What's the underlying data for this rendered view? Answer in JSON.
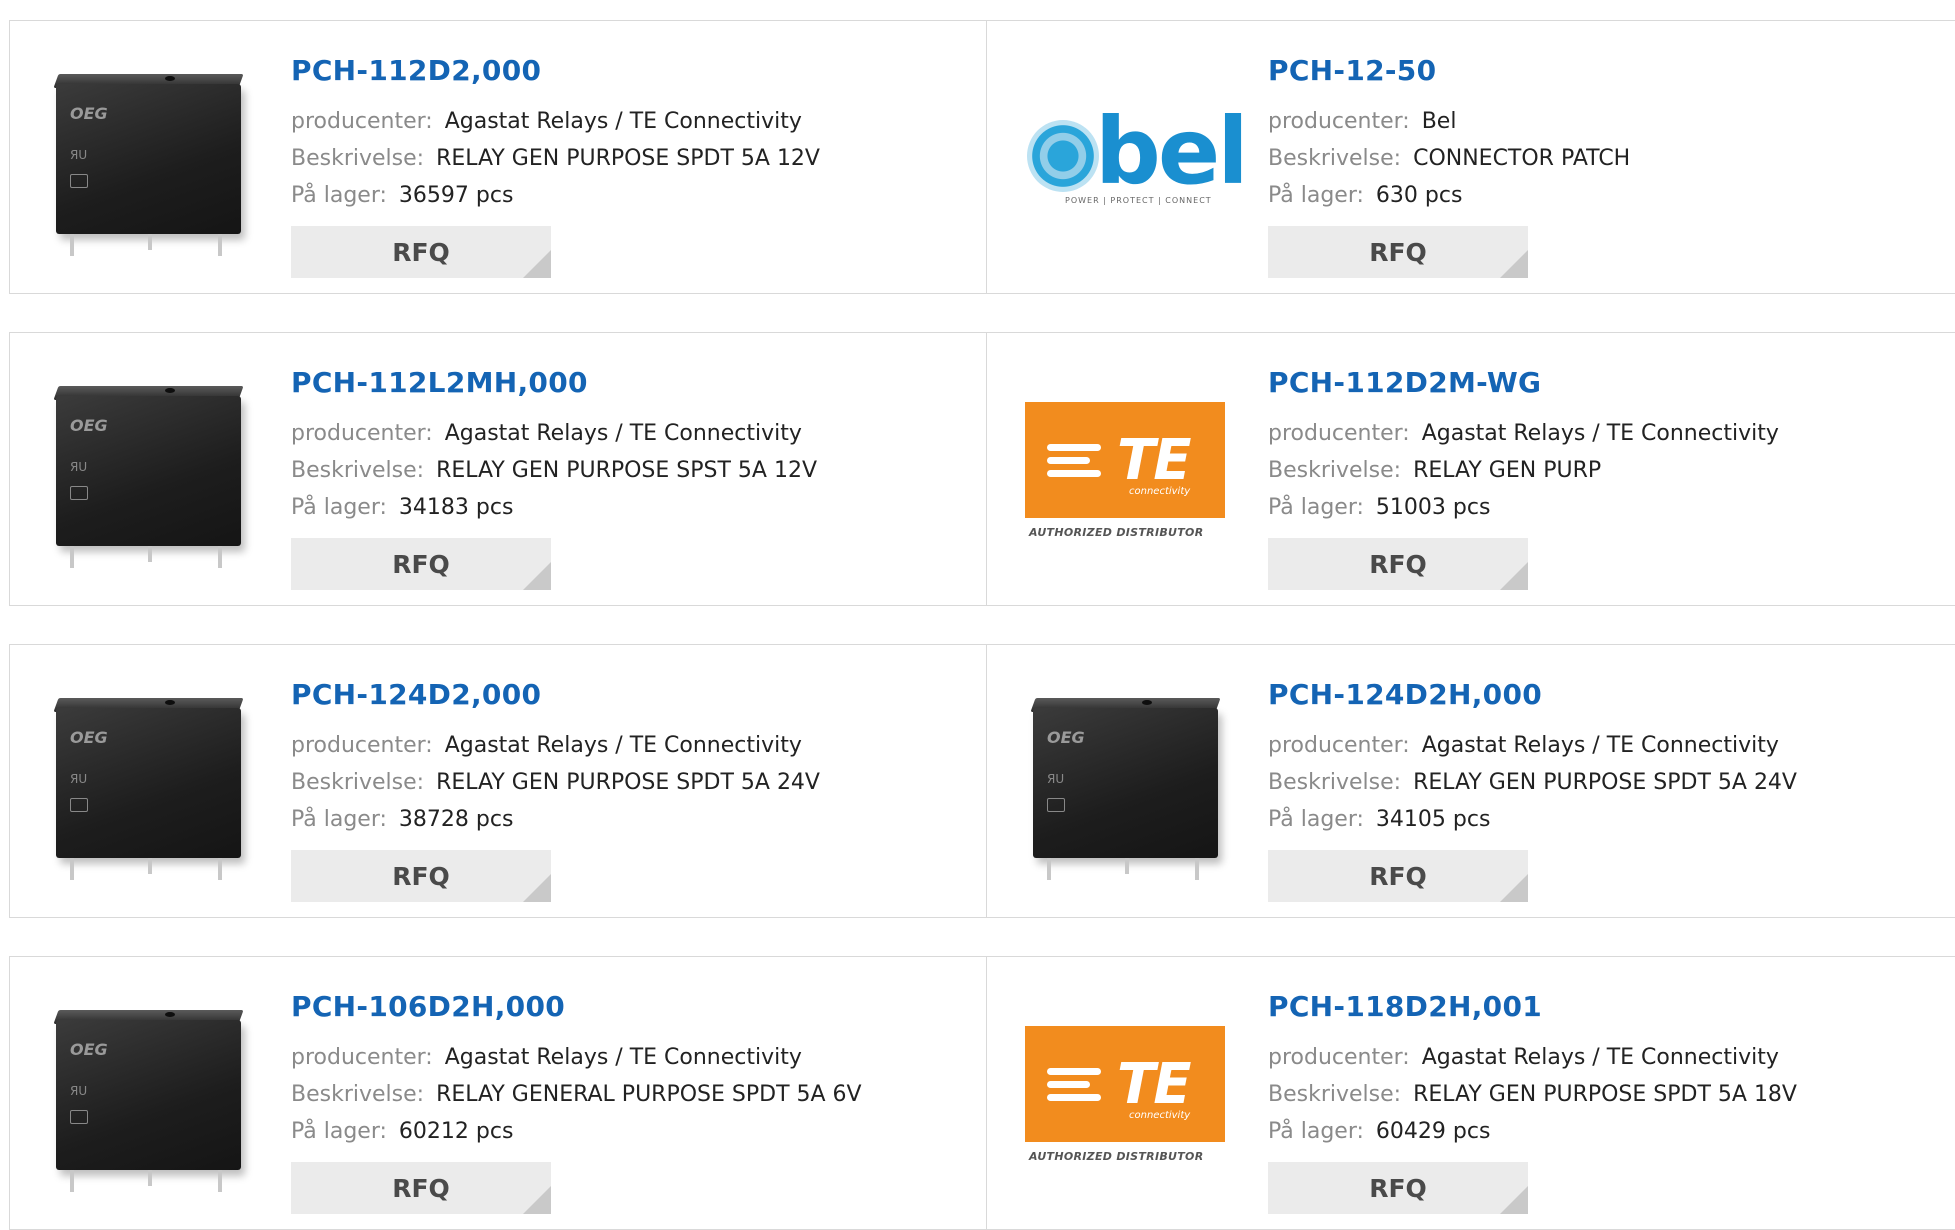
{
  "labels": {
    "manufacturer": "producenter:",
    "description": "Beskrivelse:",
    "stock": "På lager:",
    "rfq": "RFQ"
  },
  "logos": {
    "bel_word": "bel",
    "bel_tagline": "POWER | PROTECT | CONNECT",
    "te_letters": "TE",
    "te_sub": "connectivity",
    "te_authorized": "AUTHORIZED DISTRIBUTOR",
    "relay_brand": "OEG",
    "relay_mark": "ЯU"
  },
  "colors": {
    "title": "#1464b4",
    "rfq_bg": "#ebebeb",
    "te_orange": "#f28c1e",
    "bel_blue": "#1a8fd0"
  },
  "products": [
    {
      "part": "PCH-112D2,000",
      "manufacturer": "Agastat Relays / TE Connectivity",
      "description": "RELAY GEN PURPOSE SPDT 5A 12V",
      "stock": "36597 pcs",
      "image": "relay"
    },
    {
      "part": "PCH-12-50",
      "manufacturer": "Bel",
      "description": "CONNECTOR PATCH",
      "stock": "630 pcs",
      "image": "bel-logo"
    },
    {
      "part": "PCH-112L2MH,000",
      "manufacturer": "Agastat Relays / TE Connectivity",
      "description": "RELAY GEN PURPOSE SPST 5A 12V",
      "stock": "34183 pcs",
      "image": "relay"
    },
    {
      "part": "PCH-112D2M-WG",
      "manufacturer": "Agastat Relays / TE Connectivity",
      "description": "RELAY GEN PURP",
      "stock": "51003 pcs",
      "image": "te-logo"
    },
    {
      "part": "PCH-124D2,000",
      "manufacturer": "Agastat Relays / TE Connectivity",
      "description": "RELAY GEN PURPOSE SPDT 5A 24V",
      "stock": "38728 pcs",
      "image": "relay"
    },
    {
      "part": "PCH-124D2H,000",
      "manufacturer": "Agastat Relays / TE Connectivity",
      "description": "RELAY GEN PURPOSE SPDT 5A 24V",
      "stock": "34105 pcs",
      "image": "relay"
    },
    {
      "part": "PCH-106D2H,000",
      "manufacturer": "Agastat Relays / TE Connectivity",
      "description": "RELAY GENERAL PURPOSE SPDT 5A 6V",
      "stock": "60212 pcs",
      "image": "relay"
    },
    {
      "part": "PCH-118D2H,001",
      "manufacturer": "Agastat Relays / TE Connectivity",
      "description": "RELAY GEN PURPOSE SPDT 5A 18V",
      "stock": "60429 pcs",
      "image": "te-logo"
    }
  ]
}
